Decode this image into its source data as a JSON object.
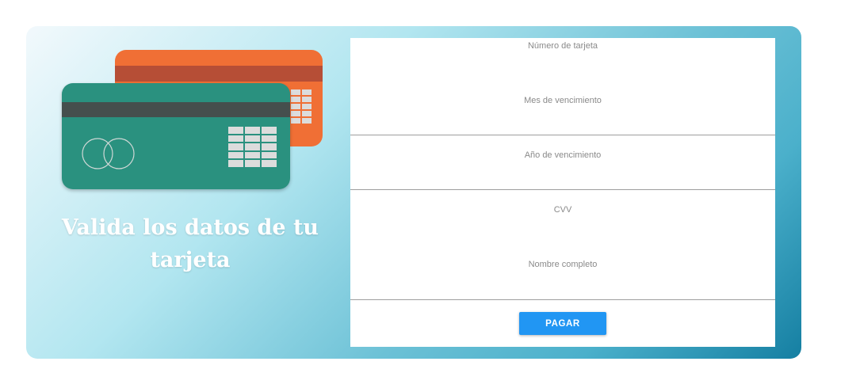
{
  "hero": {
    "title": "Valida los datos de tu tarjeta"
  },
  "illustration": {
    "front_card_color": "#2a917f",
    "back_card_color": "#f06f35",
    "icon": "credit-cards-icon"
  },
  "form": {
    "fields": [
      {
        "label": "Número de tarjeta"
      },
      {
        "label": "Mes de vencimiento"
      },
      {
        "label": "Año de vencimiento"
      },
      {
        "label": "CVV"
      },
      {
        "label": "Nombre completo"
      }
    ],
    "submit_label": "PAGAR",
    "submit_color": "#2196f3"
  }
}
